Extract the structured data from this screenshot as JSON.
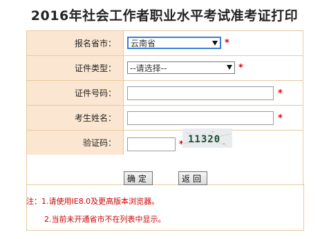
{
  "title": "2016年社会工作者职业水平考试准考证打印",
  "form": {
    "province": {
      "label": "报名省市：",
      "value": "云南省"
    },
    "id_type": {
      "label": "证件类型：",
      "value": "--请选择--"
    },
    "id_number": {
      "label": "证件号码：",
      "value": ""
    },
    "name": {
      "label": "考生姓名：",
      "value": ""
    },
    "captcha": {
      "label": "验证码：",
      "value": "",
      "image_text": "11320"
    },
    "required_mark": "*"
  },
  "buttons": {
    "confirm": "确定",
    "back": "返回"
  },
  "notes": {
    "line1": "注：1.请使用IE8.0及更高版本浏览器。",
    "line2": "2.当前未开通省市不在列表中显示。"
  },
  "colors": {
    "label_bg": "#fbe6d1",
    "border": "#e7c99f",
    "required": "#e00000",
    "note": "#cc0000"
  }
}
